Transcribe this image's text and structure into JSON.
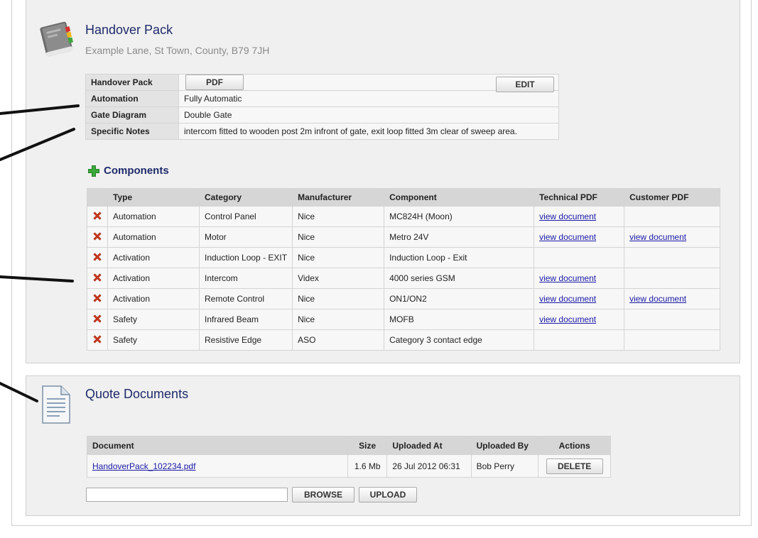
{
  "handover": {
    "title": "Handover Pack",
    "address": "Example Lane, St Town, County, B79 7JH",
    "info_rows": {
      "handover_pack_label": "Handover Pack",
      "pdf_button": "PDF",
      "edit_button": "EDIT",
      "automation_label": "Automation",
      "automation_value": "Fully Automatic",
      "gate_diagram_label": "Gate Diagram",
      "gate_diagram_value": "Double Gate",
      "specific_notes_label": "Specific Notes",
      "specific_notes_value": "intercom fitted to wooden post 2m infront of gate, exit loop fitted 3m clear of sweep area."
    }
  },
  "components": {
    "heading": "Components",
    "add_icon": "plus-icon",
    "delete_icon": "red-x-icon",
    "columns": [
      "Type",
      "Category",
      "Manufacturer",
      "Component",
      "Technical PDF",
      "Customer PDF"
    ],
    "rows": [
      {
        "type": "Automation",
        "category": "Control Panel",
        "manufacturer": "Nice",
        "component": "MC824H (Moon)",
        "technical_pdf": "view document",
        "customer_pdf": ""
      },
      {
        "type": "Automation",
        "category": "Motor",
        "manufacturer": "Nice",
        "component": "Metro 24V",
        "technical_pdf": "view document",
        "customer_pdf": "view document"
      },
      {
        "type": "Activation",
        "category": "Induction Loop - EXIT",
        "manufacturer": "Nice",
        "component": "Induction Loop - Exit",
        "technical_pdf": "",
        "customer_pdf": ""
      },
      {
        "type": "Activation",
        "category": "Intercom",
        "manufacturer": "Videx",
        "component": "4000 series GSM",
        "technical_pdf": "view document",
        "customer_pdf": ""
      },
      {
        "type": "Activation",
        "category": "Remote Control",
        "manufacturer": "Nice",
        "component": "ON1/ON2",
        "technical_pdf": "view document",
        "customer_pdf": "view document"
      },
      {
        "type": "Safety",
        "category": "Infrared Beam",
        "manufacturer": "Nice",
        "component": "MOFB",
        "technical_pdf": "view document",
        "customer_pdf": ""
      },
      {
        "type": "Safety",
        "category": "Resistive Edge",
        "manufacturer": "ASO",
        "component": "Category 3 contact edge",
        "technical_pdf": "",
        "customer_pdf": ""
      }
    ]
  },
  "quote_documents": {
    "title": "Quote Documents",
    "columns": {
      "document": "Document",
      "size": "Size",
      "uploaded_at": "Uploaded At",
      "uploaded_by": "Uploaded By",
      "actions": "Actions"
    },
    "rows": [
      {
        "document": "HandoverPack_102234.pdf",
        "size": "1.6 Mb",
        "uploaded_at": "26 Jul 2012 06:31",
        "uploaded_by": "Bob Perry",
        "action": "DELETE"
      }
    ],
    "file_input_value": "",
    "browse_button": "BROWSE",
    "upload_button": "UPLOAD"
  },
  "colors": {
    "title": "#1e2a6a",
    "link": "#1a1aa6",
    "panel": "#f0f0f0",
    "delete_icon": "#d23a1e",
    "add_icon": "#3aa83a"
  }
}
